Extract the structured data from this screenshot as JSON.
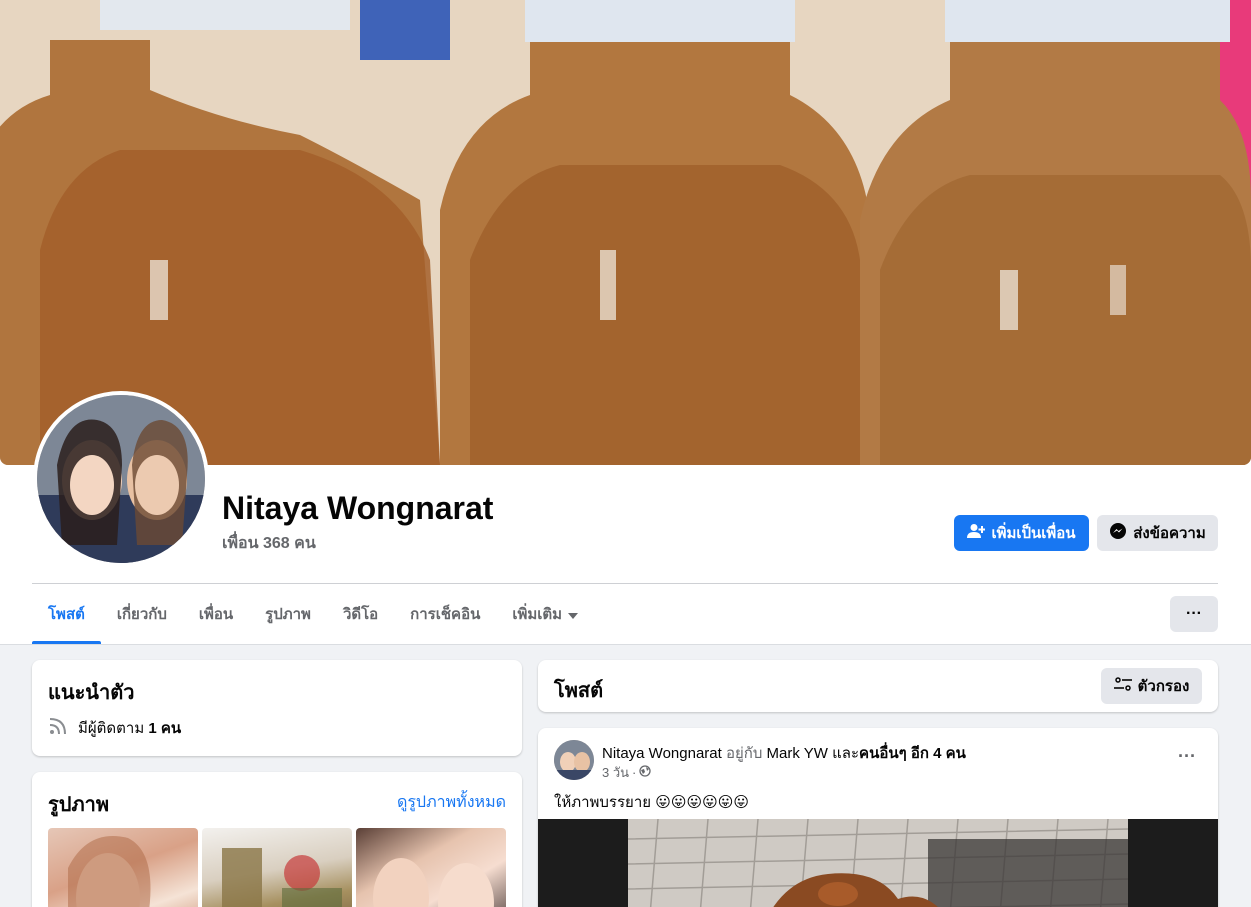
{
  "profile": {
    "name": "Nitaya Wongnarat",
    "friends_count": "เพื่อน 368 คน"
  },
  "actions": {
    "add_friend_label": "เพิ่มเป็นเพื่อน",
    "message_label": "ส่งข้อความ",
    "more_label": "···"
  },
  "tabs": [
    {
      "label": "โพสต์",
      "active": true
    },
    {
      "label": "เกี่ยวกับ",
      "active": false
    },
    {
      "label": "เพื่อน",
      "active": false
    },
    {
      "label": "รูปภาพ",
      "active": false
    },
    {
      "label": "วิดีโอ",
      "active": false
    },
    {
      "label": "การเช็คอิน",
      "active": false
    },
    {
      "label": "เพิ่มเติม",
      "active": false
    }
  ],
  "intro": {
    "title": "แนะนำตัว",
    "followers_prefix": "มีผู้ติดตาม",
    "followers_count": "1 คน"
  },
  "photos": {
    "title": "รูปภาพ",
    "see_all": "ดูรูปภาพทั้งหมด"
  },
  "posts": {
    "title": "โพสต์",
    "filter_label": "ตัวกรอง"
  },
  "post": {
    "author": "Nitaya Wongnarat",
    "with_text": "อยู่กับ",
    "tagged": "Mark YW",
    "and_text": "และ",
    "others": "คนอื่นๆ อีก 4 คน",
    "time": "3 วัน",
    "separator": "·",
    "body": "ให้ภาพบรรยาย 😛😛😛😛😛😛"
  },
  "colors": {
    "brand": "#1877f2",
    "background": "#f0f2f5",
    "secondary_text": "#65676b"
  },
  "icons": [
    "add-friend-icon",
    "messenger-icon",
    "more-icon",
    "caret-down-icon",
    "rss-icon",
    "filter-icon",
    "globe-icon"
  ]
}
